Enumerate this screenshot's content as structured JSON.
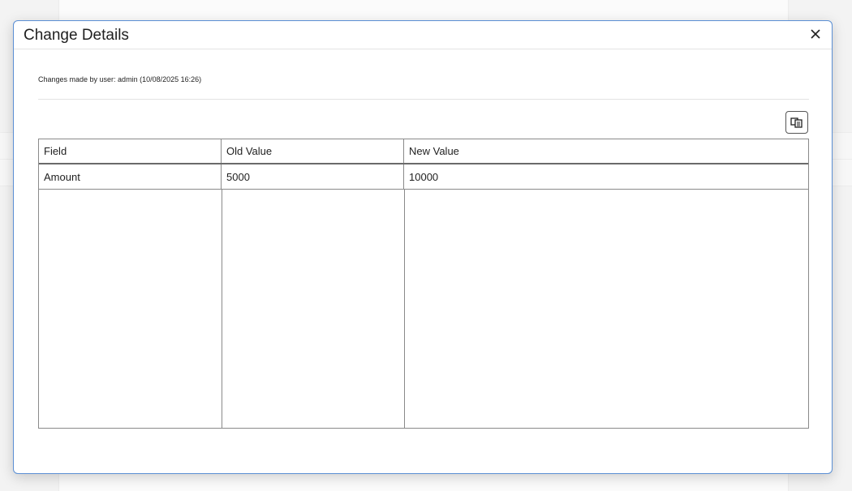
{
  "dialog": {
    "title": "Change Details",
    "close_label": "×",
    "info_text": "Changes made by user: admin (10/08/2025 16:26)"
  },
  "toolbar": {
    "export_icon": "copy-export-icon"
  },
  "table": {
    "columns": [
      "Field",
      "Old Value",
      "New Value"
    ],
    "rows": [
      [
        "Amount",
        "5000",
        "10000"
      ]
    ]
  },
  "colors": {
    "dialog_border": "#5b8fd4",
    "grid_border": "#8a8a8a"
  }
}
